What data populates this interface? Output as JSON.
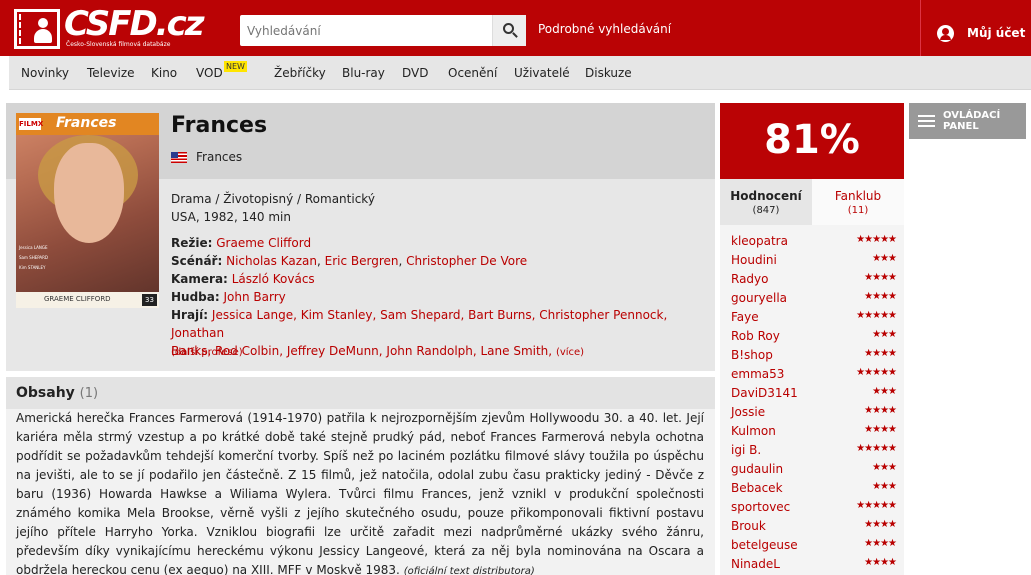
{
  "header": {
    "logo_text": "CSFD.cz",
    "logo_subtitle": "Česko-Slovenská filmová databáze",
    "search_placeholder": "Vyhledávání",
    "advanced_search": "Podrobné vyhledávání",
    "account": "Můj účet"
  },
  "nav": {
    "items": [
      "Novinky",
      "Televize",
      "Kino",
      "VOD",
      "Žebříčky",
      "Blu-ray",
      "DVD",
      "Ocenění",
      "Uživatelé",
      "Diskuze"
    ],
    "vod_badge": "NEW"
  },
  "film": {
    "title": "Frances",
    "country_title": "Frances",
    "genres": "Drama / Životopisný / Romantický",
    "origin": "USA, 1982, 140 min",
    "direction_label": "Režie:",
    "direction": [
      "Graeme Clifford"
    ],
    "screenplay_label": "Scénář:",
    "screenplay": [
      "Nicholas Kazan",
      "Eric Bergren",
      "Christopher De Vore"
    ],
    "camera_label": "Kamera:",
    "camera": [
      "László Kovács"
    ],
    "music_label": "Hudba:",
    "music": [
      "John Barry"
    ],
    "cast_label": "Hrají:",
    "cast_line1": "Jessica Lange, Kim Stanley, Sam Shepard, Bart Burns, Christopher Pennock, Jonathan",
    "cast_line2": "Banks, Rod Colbin, Jeffrey DeMunn, John Randolph, Lane Smith,",
    "cast_more": "(více)",
    "more_professions": "(další profese)",
    "poster": {
      "logo": "FILMX",
      "title": "Frances",
      "cast_lines": [
        "Jessica LANGE",
        "Sam SHEPARD",
        "Kim STANLEY"
      ],
      "director": "GRAEME CLIFFORD",
      "number": "33"
    }
  },
  "plot": {
    "heading": "Obsahy",
    "count": "(1)",
    "text": "Americká herečka Frances Farmerová (1914-1970) patřila k nejrozpornějším zjevům Hollywoodu 30. a 40. let. Její kariéra měla strmý vzestup a po krátké době také stejně prudký pád, neboť Frances Farmerová nebyla ochotna podřídit se požadavkům tehdejší komerční tvorby. Spíš než po laciném pozlátku filmové slávy toužila po úspěchu na jevišti, ale to se jí podařilo jen částečně. Z 15 filmů, jež natočila, odolal zubu času prakticky jediný - Děvče z baru (1936) Howarda Hawkse a Wiliama Wylera. Tvůrci filmu Frances, jenž vznikl v produkční společnosti známého komika Mela Brookse, věrně vyšli z jejího skutečného osudu, pouze přikomponovali fiktivní postavu jejího přítele Harryho Yorka. Vzniklou biografii lze určitě zařadit mezi nadprůměrné ukázky svého žánru, především díky vynikajícímu hereckému výkonu Jessicy Langeové, která za něj byla nominována na Oscara a obdržela hereckou cenu (ex aequo) na XIII. MFF v Moskvě 1983.",
    "source": "(oficiální text distributora)"
  },
  "rating": {
    "value": "81%",
    "tab_ratings": "Hodnocení",
    "tab_ratings_count": "(847)",
    "tab_fanclub": "Fanklub",
    "tab_fanclub_count": "(11)",
    "raters": [
      {
        "name": "kleopatra",
        "stars": "★★★★★"
      },
      {
        "name": "Houdini",
        "stars": "★★★"
      },
      {
        "name": "Radyo",
        "stars": "★★★★"
      },
      {
        "name": "gouryella",
        "stars": "★★★★"
      },
      {
        "name": "Faye",
        "stars": "★★★★★"
      },
      {
        "name": "Rob Roy",
        "stars": "★★★"
      },
      {
        "name": "B!shop",
        "stars": "★★★★"
      },
      {
        "name": "emma53",
        "stars": "★★★★★"
      },
      {
        "name": "DaviD3141",
        "stars": "★★★"
      },
      {
        "name": "Jossie",
        "stars": "★★★★"
      },
      {
        "name": "Kulmon",
        "stars": "★★★★"
      },
      {
        "name": "igi B.",
        "stars": "★★★★★"
      },
      {
        "name": "gudaulin",
        "stars": "★★★"
      },
      {
        "name": "Bebacek",
        "stars": "★★★"
      },
      {
        "name": "sportovec",
        "stars": "★★★★★"
      },
      {
        "name": "Brouk",
        "stars": "★★★★"
      },
      {
        "name": "betelgeuse",
        "stars": "★★★★"
      },
      {
        "name": "NinadeL",
        "stars": "★★★★"
      }
    ]
  },
  "control_panel": {
    "line1": "OVLÁDACÍ",
    "line2": "PANEL"
  },
  "colors": {
    "brand_red": "#ba0305",
    "link_red": "#b90000",
    "badge_yellow": "#ffe500"
  }
}
